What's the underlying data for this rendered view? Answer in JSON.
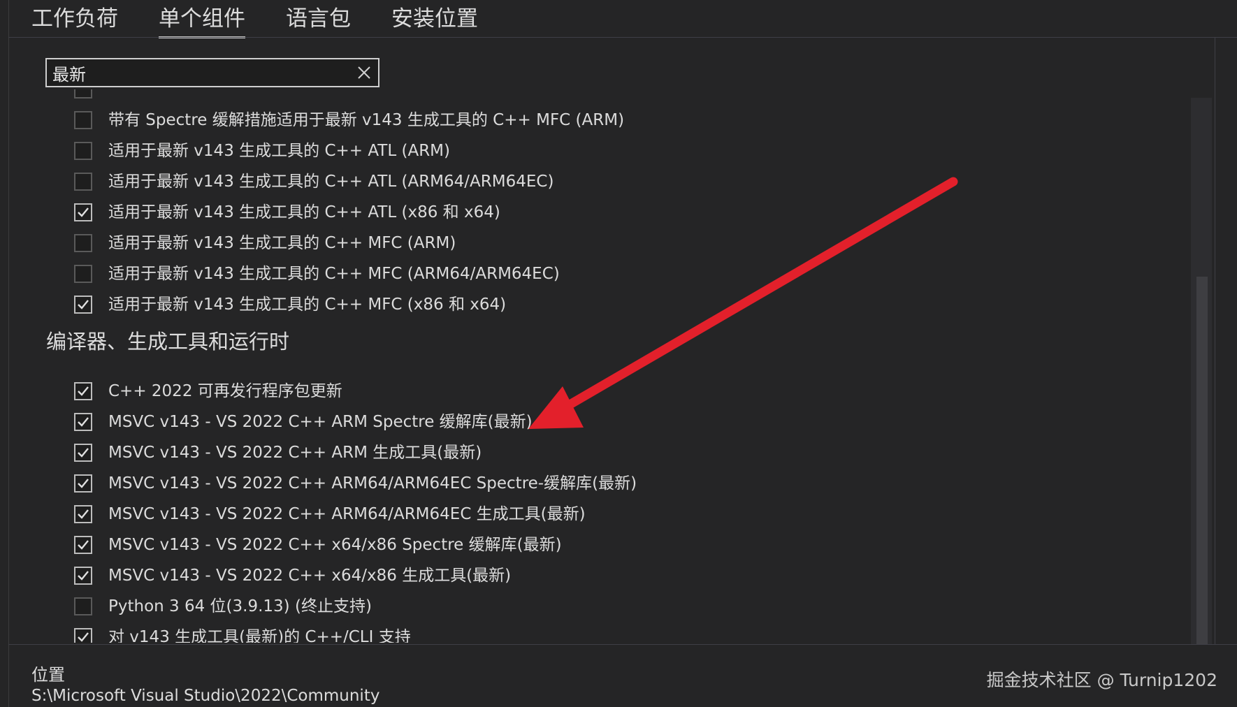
{
  "tabs": [
    {
      "label": "工作负荷",
      "active": false
    },
    {
      "label": "单个组件",
      "active": true
    },
    {
      "label": "语言包",
      "active": false
    },
    {
      "label": "安装位置",
      "active": false
    }
  ],
  "search": {
    "value": "最新"
  },
  "list_top": [
    {
      "label": "带有 Spectre 缓解措施适用于最新 v143 生成工具的 C++ MFC (ARM)",
      "checked": false
    },
    {
      "label": "适用于最新 v143 生成工具的 C++ ATL (ARM)",
      "checked": false
    },
    {
      "label": "适用于最新 v143 生成工具的 C++ ATL (ARM64/ARM64EC)",
      "checked": false
    },
    {
      "label": "适用于最新 v143 生成工具的 C++ ATL (x86 和 x64)",
      "checked": true
    },
    {
      "label": "适用于最新 v143 生成工具的 C++ MFC (ARM)",
      "checked": false
    },
    {
      "label": "适用于最新 v143 生成工具的 C++ MFC (ARM64/ARM64EC)",
      "checked": false
    },
    {
      "label": "适用于最新 v143 生成工具的 C++ MFC (x86 和 x64)",
      "checked": true
    }
  ],
  "section": {
    "heading": "编译器、生成工具和运行时",
    "items": [
      {
        "label": "C++ 2022 可再发行程序包更新",
        "checked": true
      },
      {
        "label": "MSVC v143 - VS 2022 C++ ARM Spectre 缓解库(最新)",
        "checked": true
      },
      {
        "label": "MSVC v143 - VS 2022 C++ ARM 生成工具(最新)",
        "checked": true
      },
      {
        "label": "MSVC v143 - VS 2022 C++ ARM64/ARM64EC Spectre-缓解库(最新)",
        "checked": true
      },
      {
        "label": "MSVC v143 - VS 2022 C++ ARM64/ARM64EC 生成工具(最新)",
        "checked": true
      },
      {
        "label": "MSVC v143 - VS 2022 C++ x64/x86 Spectre 缓解库(最新)",
        "checked": true
      },
      {
        "label": "MSVC v143 - VS 2022 C++ x64/x86 生成工具(最新)",
        "checked": true
      },
      {
        "label": "Python 3 64 位(3.9.13) (终止支持)",
        "checked": false
      },
      {
        "label": "对 v143 生成工具(最新)的 C++/CLI 支持",
        "checked": true
      }
    ]
  },
  "footer": {
    "location_label": "位置",
    "location_path": "S:\\Microsoft Visual Studio\\2022\\Community"
  },
  "watermark": "掘金技术社区 @ Turnip1202",
  "colors": {
    "arrow": "#e3202b",
    "background": "#252526"
  }
}
